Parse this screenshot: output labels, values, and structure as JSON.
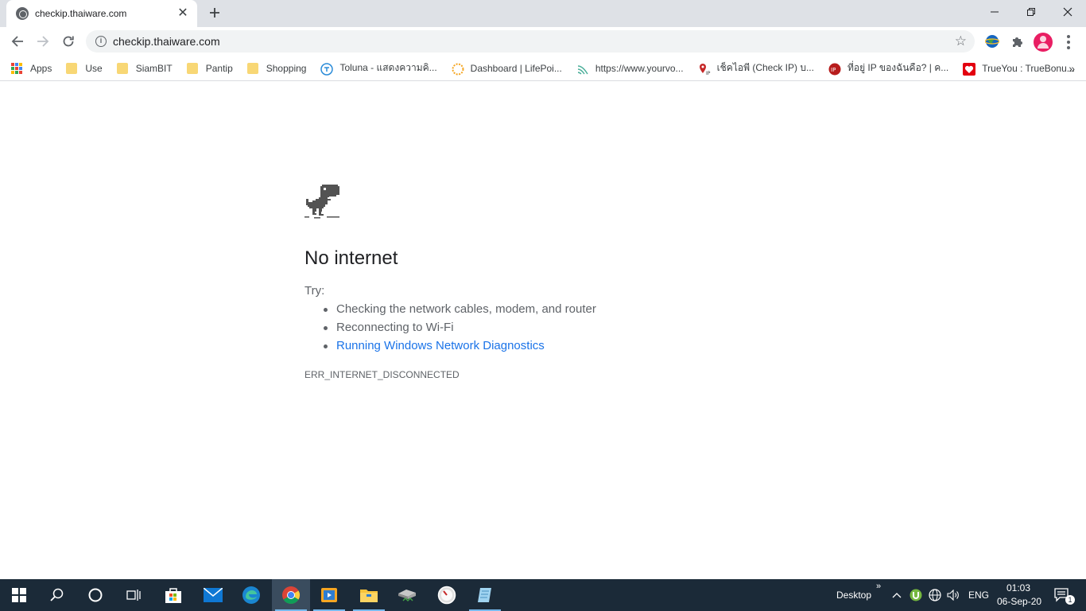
{
  "tab": {
    "title": "checkip.thaiware.com",
    "close": "✕"
  },
  "window_controls": {
    "minimize": "—",
    "restore": "❐",
    "close": "✕"
  },
  "toolbar": {
    "url": "checkip.thaiware.com"
  },
  "bookmarks": [
    {
      "label": "Apps",
      "icon": "apps-grid-icon"
    },
    {
      "label": "Use",
      "icon": "folder-icon"
    },
    {
      "label": "SiamBIT",
      "icon": "folder-icon"
    },
    {
      "label": "Pantip",
      "icon": "folder-icon"
    },
    {
      "label": "Shopping",
      "icon": "folder-icon"
    },
    {
      "label": "Toluna - แสดงความคิ...",
      "icon": "toluna-icon"
    },
    {
      "label": "Dashboard | LifePoi...",
      "icon": "lifepoints-icon"
    },
    {
      "label": "https://www.yourvo...",
      "icon": "yourvoice-icon"
    },
    {
      "label": "เช็คไอพี (Check IP) บ...",
      "icon": "checkip-icon"
    },
    {
      "label": "ที่อยู่ IP ของฉันคือ? | ค...",
      "icon": "whatismyip-icon"
    },
    {
      "label": "TrueYou : TrueBonu...",
      "icon": "trueyou-icon"
    }
  ],
  "error": {
    "title": "No internet",
    "try_label": "Try:",
    "suggestions": [
      "Checking the network cables, modem, and router",
      "Reconnecting to Wi-Fi",
      "Running Windows Network Diagnostics"
    ],
    "code": "ERR_INTERNET_DISCONNECTED"
  },
  "taskbar": {
    "desktop_label": "Desktop",
    "language": "ENG",
    "time": "01:03",
    "date": "06-Sep-20",
    "notification_count": "1"
  },
  "colors": {
    "link": "#1a73e8",
    "taskbar": "#1b2a38",
    "tabstrip": "#dee1e6",
    "folder": "#f8d775"
  }
}
